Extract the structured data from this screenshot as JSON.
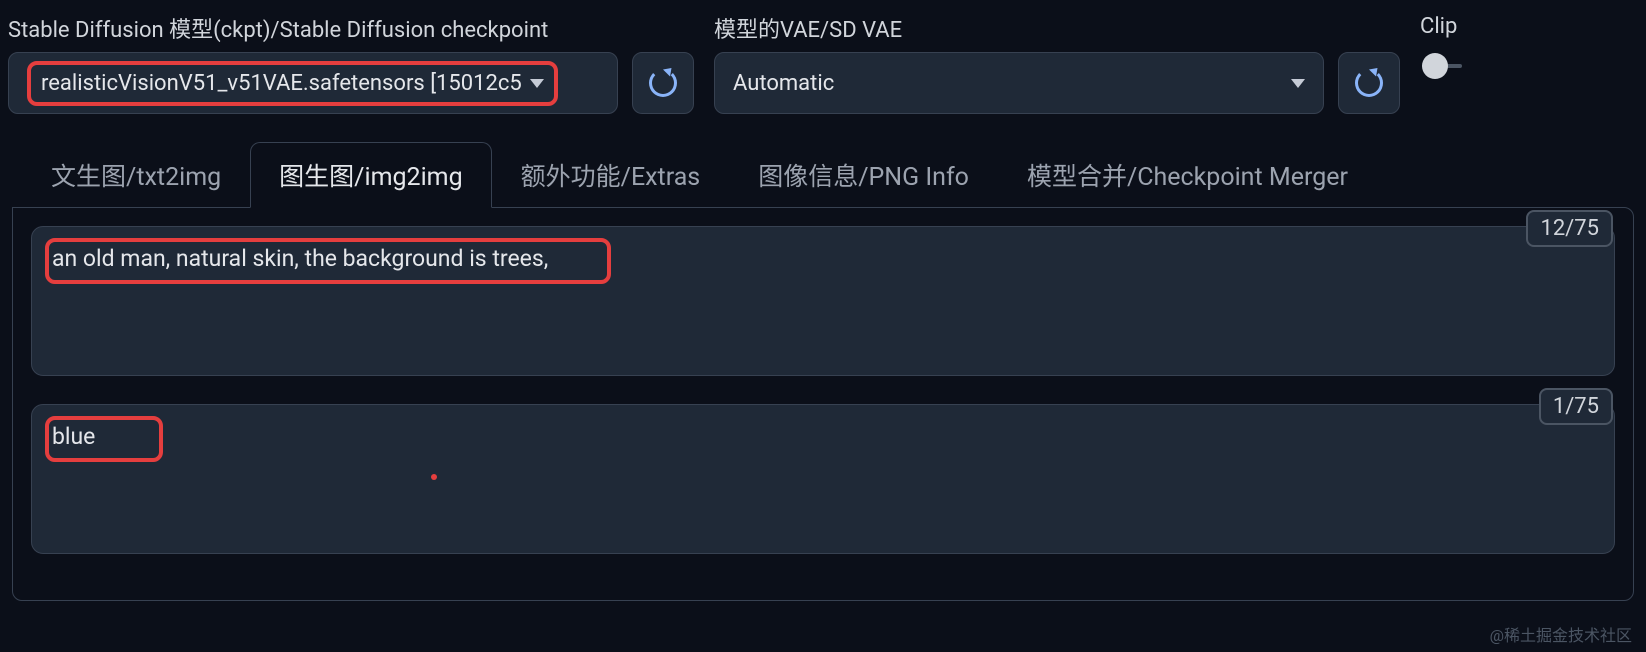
{
  "header": {
    "checkpoint_label": "Stable Diffusion 模型(ckpt)/Stable Diffusion checkpoint",
    "checkpoint_value": "realisticVisionV51_v51VAE.safetensors [15012c5",
    "vae_label": "模型的VAE/SD VAE",
    "vae_value": "Automatic",
    "clip_label": "Clip"
  },
  "tabs": [
    {
      "label": "文生图/txt2img"
    },
    {
      "label": "图生图/img2img"
    },
    {
      "label": "额外功能/Extras"
    },
    {
      "label": "图像信息/PNG Info"
    },
    {
      "label": "模型合并/Checkpoint Merger"
    }
  ],
  "prompt": {
    "value": "an old man, natural skin, the background is trees,",
    "token_counter": "12/75"
  },
  "neg_prompt": {
    "value": "blue",
    "token_counter": "1/75"
  },
  "watermark": "@稀土掘金技术社区"
}
